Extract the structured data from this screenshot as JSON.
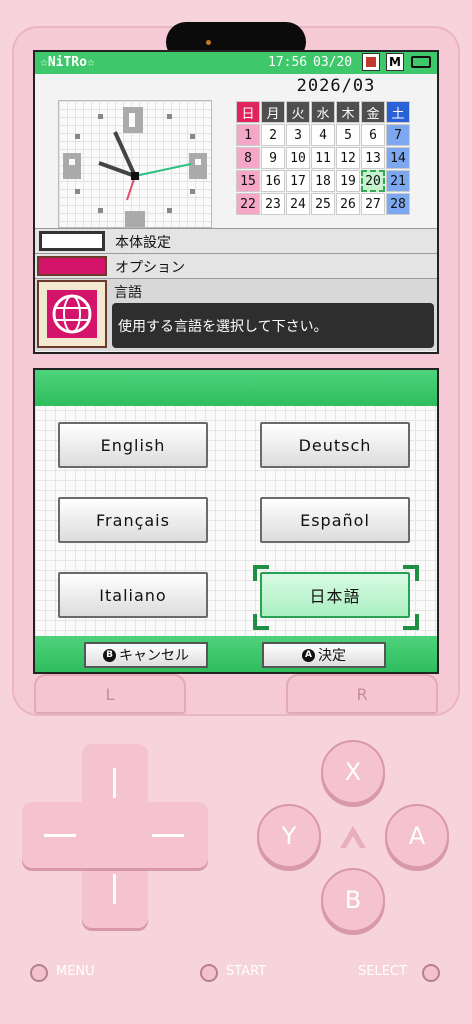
{
  "status": {
    "username": "☆NiTRo☆",
    "time": "17:56",
    "date": "03/20"
  },
  "calendar": {
    "year_month": "2026/03",
    "weekdays": [
      "日",
      "月",
      "火",
      "水",
      "木",
      "金",
      "土"
    ],
    "weeks": [
      [
        "1",
        "2",
        "3",
        "4",
        "5",
        "6",
        "7"
      ],
      [
        "8",
        "9",
        "10",
        "11",
        "12",
        "13",
        "14"
      ],
      [
        "15",
        "16",
        "17",
        "18",
        "19",
        "20",
        "21"
      ],
      [
        "22",
        "23",
        "24",
        "25",
        "26",
        "27",
        "28"
      ]
    ],
    "today": "20"
  },
  "menu": {
    "settings": "本体設定",
    "options": "オプション",
    "language": "言語"
  },
  "language_description": "使用する言語を選択して下さい。",
  "languages": [
    "English",
    "Deutsch",
    "Français",
    "Español",
    "Italiano",
    "日本語"
  ],
  "selected_language": "日本語",
  "bottom_buttons": {
    "cancel_badge": "B",
    "cancel": "キャンセル",
    "confirm_badge": "A",
    "confirm": "決定"
  },
  "shoulders": {
    "left": "L",
    "right": "R"
  },
  "face_buttons": {
    "x": "X",
    "y": "Y",
    "a": "A",
    "b": "B"
  },
  "system_buttons": {
    "menu": "MENU",
    "start": "START",
    "select": "SELECT"
  },
  "colors": {
    "accent_green": "#3ec86b",
    "shell_pink": "#f5c9d5",
    "sunday": "#e0245c",
    "saturday": "#2a61d6"
  }
}
